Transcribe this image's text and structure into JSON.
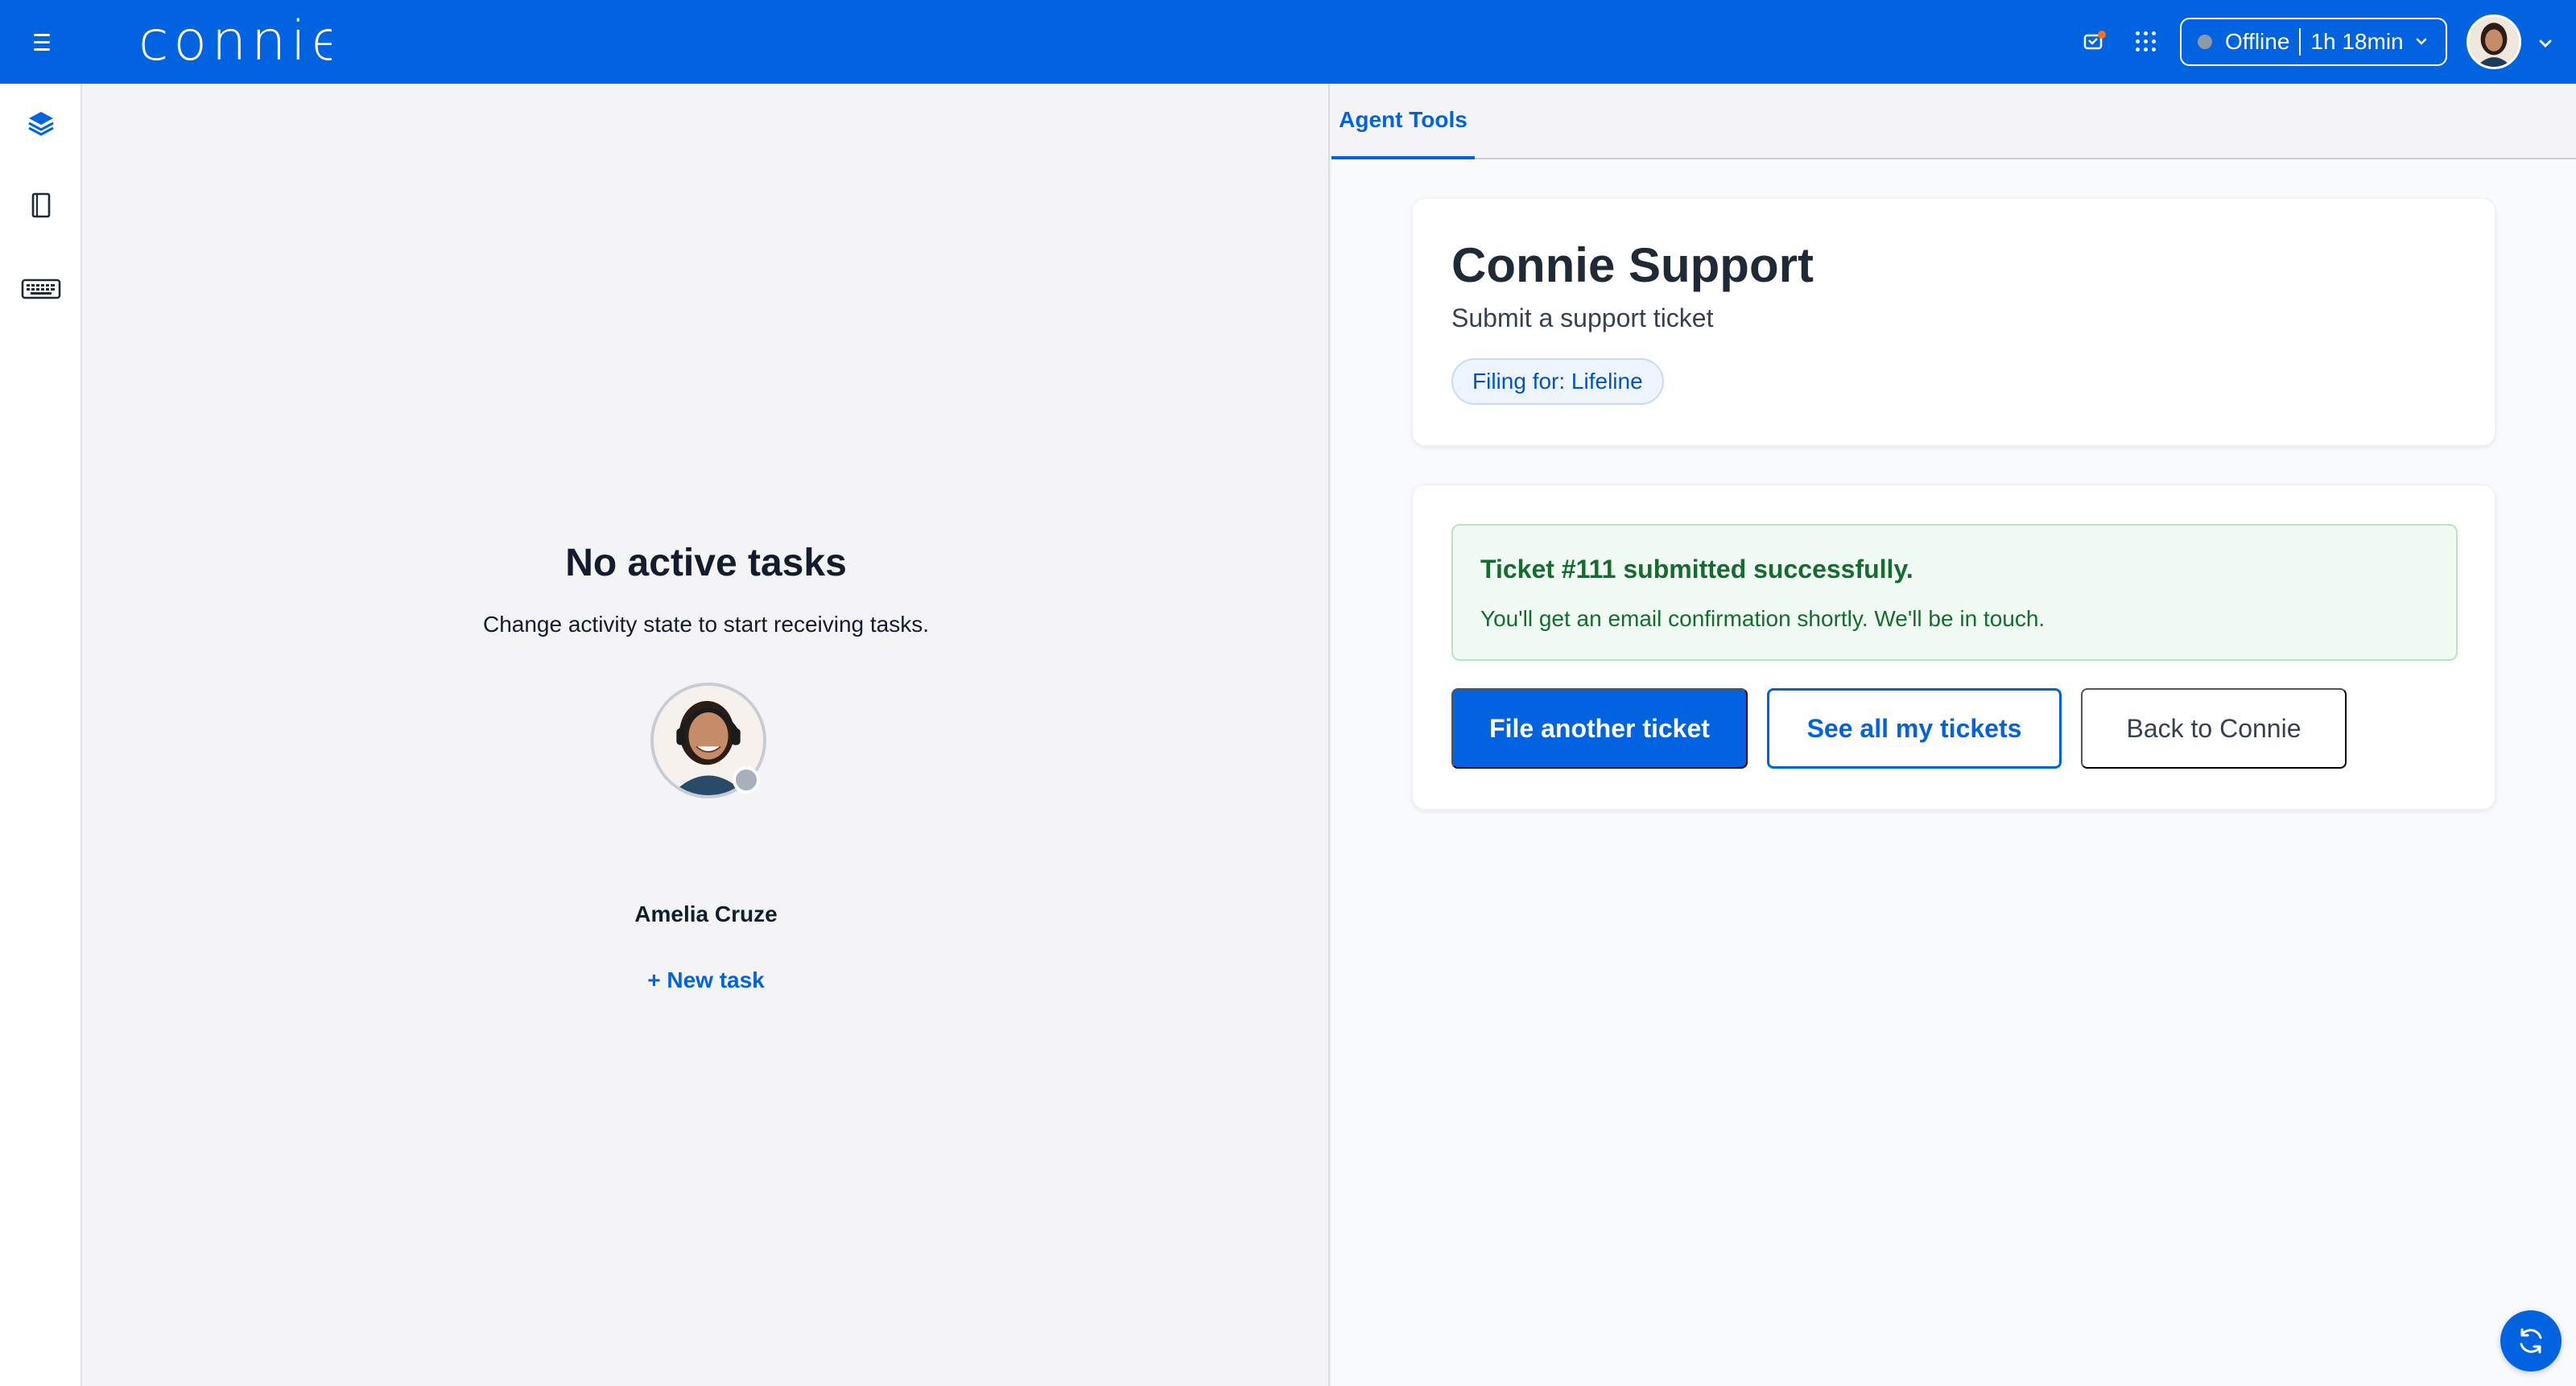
{
  "app": {
    "logo_text": "connie"
  },
  "topbar": {
    "status": "Offline",
    "duration": "1h 18min"
  },
  "tasks": {
    "empty_title": "No active tasks",
    "empty_subtitle": "Change activity state to start receiving tasks.",
    "agent_name": "Amelia Cruze",
    "new_task_label": "+ New task"
  },
  "tools": {
    "tab_label": "Agent Tools",
    "title": "Connie Support",
    "subtitle": "Submit a support ticket",
    "filing_for": "Filing for: Lifeline",
    "alert_title": "Ticket #111 submitted successfully.",
    "alert_body": "You'll get an email confirmation shortly. We'll be in touch.",
    "btn_file_another": "File another ticket",
    "btn_see_all": "See all my tickets",
    "btn_back": "Back to Connie"
  },
  "colors": {
    "brand": "#0263e0",
    "success_bg": "#f0fbf3",
    "success_text": "#146c2e",
    "offline": "#8e99a8"
  },
  "icons": {
    "rail": [
      "layers-icon",
      "notebook-icon",
      "keyboard-icon"
    ],
    "topbar": [
      "menu-icon",
      "notification-icon",
      "app-grid-icon",
      "chevron-down-icon"
    ],
    "fab": "refresh-icon"
  }
}
